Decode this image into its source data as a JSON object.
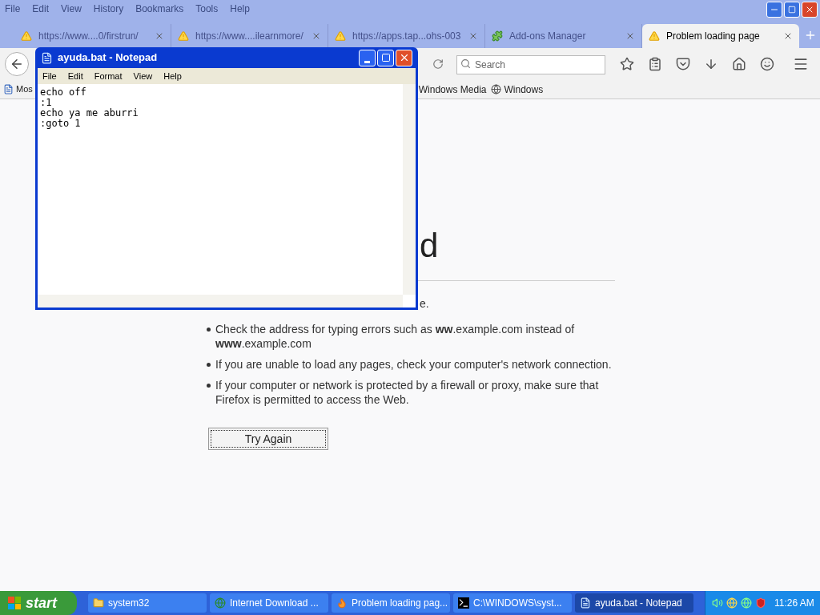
{
  "firefox": {
    "menu": [
      "File",
      "Edit",
      "View",
      "History",
      "Bookmarks",
      "Tools",
      "Help"
    ],
    "tabs": [
      {
        "title": "https://www....0/firstrun/",
        "kind": "warning",
        "selected": false
      },
      {
        "title": "https://www....ilearnmore/",
        "kind": "warning",
        "selected": false
      },
      {
        "title": "https://apps.tap...ohs-003",
        "kind": "warning",
        "selected": false
      },
      {
        "title": "Add-ons Manager",
        "kind": "addons",
        "selected": false
      },
      {
        "title": "Problem loading page",
        "kind": "warning",
        "selected": true
      }
    ],
    "search": {
      "placeholder": "Search"
    },
    "bookmarks": [
      {
        "label": "Mos",
        "kind": "page"
      },
      {
        "label": "Windows Media",
        "kind": "none"
      },
      {
        "label": "Windows",
        "kind": "globe"
      }
    ],
    "page": {
      "heading": "d",
      "intro": "e.",
      "bullets": [
        "Check the address for typing errors such as **ww**.example.com instead of **www**.example.com",
        "If you are unable to load any pages, check your computer's network connection.",
        "If your computer or network is protected by a firewall or proxy, make sure that Firefox is permitted to access the Web."
      ],
      "button": "Try Again"
    }
  },
  "notepad": {
    "title": "ayuda.bat - Notepad",
    "menu": [
      "File",
      "Edit",
      "Format",
      "View",
      "Help"
    ],
    "lines": [
      "echo off",
      ":1",
      "echo ya me aburri",
      ":goto 1"
    ]
  },
  "taskbar": {
    "start": "start",
    "tasks": [
      {
        "label": "system32",
        "kind": "folder",
        "selected": false
      },
      {
        "label": "Internet Download ...",
        "kind": "idm",
        "selected": false
      },
      {
        "label": "Problem loading pag...",
        "kind": "firefox",
        "selected": false
      },
      {
        "label": "C:\\WINDOWS\\syst...",
        "kind": "cmd",
        "selected": false
      },
      {
        "label": "ayuda.bat - Notepad",
        "kind": "notepad",
        "selected": true
      }
    ],
    "clock": "11:26 AM"
  }
}
